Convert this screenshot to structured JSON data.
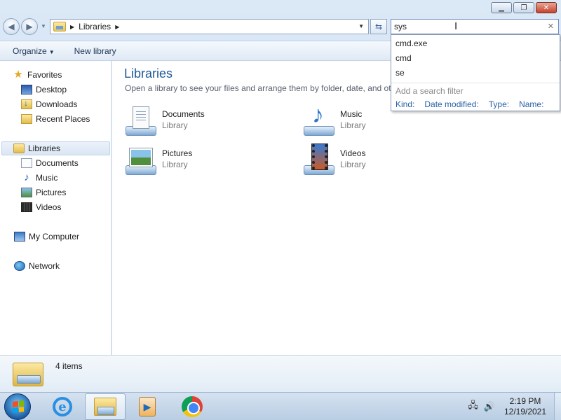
{
  "window": {
    "minimize_glyph": "▁",
    "restore_glyph": "❐",
    "close_glyph": "✕"
  },
  "nav": {
    "back_glyph": "◀",
    "forward_glyph": "▶",
    "address_separator": "▶",
    "address_segment": "Libraries",
    "address_trailing_separator": "▶",
    "refresh_glyph": "⇆"
  },
  "search": {
    "value": "sys",
    "clear_glyph": "✕",
    "cursor_glyph": "I",
    "suggestions": [
      "cmd.exe",
      "cmd",
      "se"
    ],
    "filter_hint": "Add a search filter",
    "filters": [
      "Kind:",
      "Date modified:",
      "Type:",
      "Name:"
    ]
  },
  "toolbar": {
    "organize_label": "Organize",
    "new_library_label": "New library"
  },
  "sidebar": {
    "favorites": {
      "label": "Favorites",
      "icon": "star-icon"
    },
    "favorites_items": [
      {
        "label": "Desktop",
        "icon": "desktop-icon"
      },
      {
        "label": "Downloads",
        "icon": "downloads-icon"
      },
      {
        "label": "Recent Places",
        "icon": "recent-places-icon"
      }
    ],
    "libraries": {
      "label": "Libraries",
      "icon": "libraries-icon"
    },
    "libraries_items": [
      {
        "label": "Documents",
        "icon": "documents-icon"
      },
      {
        "label": "Music",
        "icon": "music-icon"
      },
      {
        "label": "Pictures",
        "icon": "pictures-icon"
      },
      {
        "label": "Videos",
        "icon": "videos-icon"
      }
    ],
    "computer": {
      "label": "My Computer",
      "icon": "computer-icon"
    },
    "network": {
      "label": "Network",
      "icon": "network-icon"
    }
  },
  "main": {
    "title": "Libraries",
    "subtitle": "Open a library to see your files and arrange them by folder, date, and other properties.",
    "libraries": [
      {
        "name": "Documents",
        "type": "Library",
        "icon": "documents-library-icon"
      },
      {
        "name": "Music",
        "type": "Library",
        "icon": "music-library-icon"
      },
      {
        "name": "Pictures",
        "type": "Library",
        "icon": "pictures-library-icon"
      },
      {
        "name": "Videos",
        "type": "Library",
        "icon": "videos-library-icon"
      }
    ]
  },
  "details": {
    "item_count": "4 items"
  },
  "taskbar": {
    "apps": [
      "internet-explorer-icon",
      "windows-explorer-icon",
      "media-player-icon",
      "chrome-icon"
    ],
    "ie_glyph": "e",
    "media_glyph": "▶",
    "time": "2:19 PM",
    "date": "12/19/2021",
    "network_glyph": "🖧",
    "volume_glyph": "🔊"
  },
  "colors": {
    "title_blue": "#1e5a9a",
    "filter_link": "#2b62a8"
  }
}
